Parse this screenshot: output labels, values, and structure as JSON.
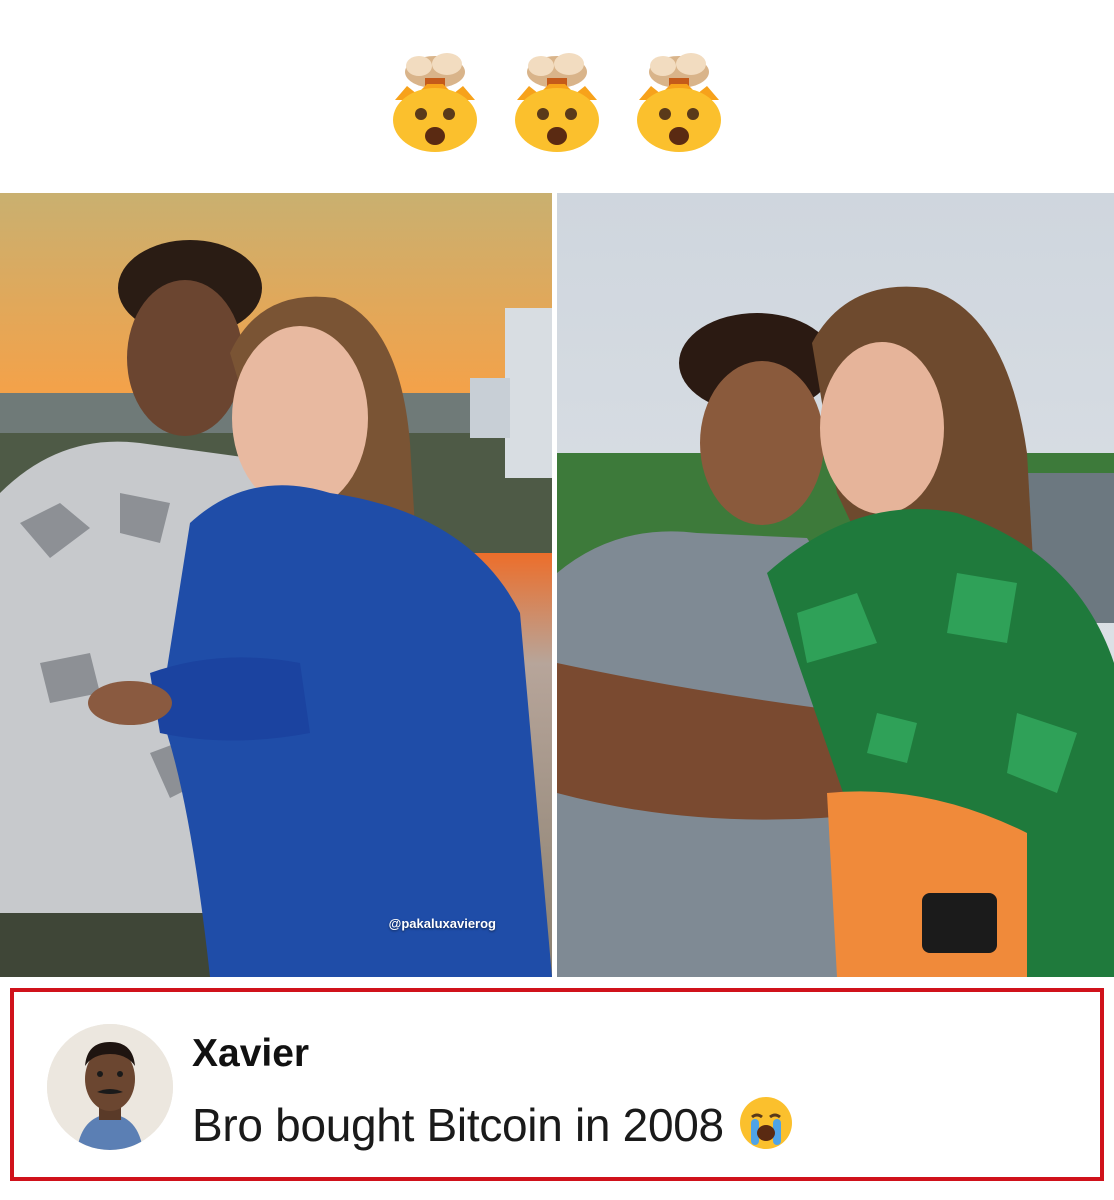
{
  "header": {
    "emojis": [
      "mind-blown-icon",
      "mind-blown-icon",
      "mind-blown-icon"
    ]
  },
  "photos": {
    "left": {
      "watermark": "@pakaluxavierog"
    },
    "right": {}
  },
  "comment": {
    "author": "Xavier",
    "text": "Bro bought Bitcoin in 2008",
    "emoji": "loudly-crying-face-icon",
    "highlight_color": "#d0121b"
  }
}
